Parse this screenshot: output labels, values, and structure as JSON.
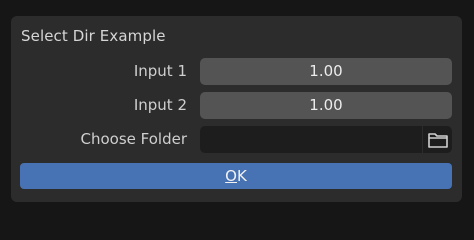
{
  "dialog": {
    "title": "Select Dir Example",
    "fields": [
      {
        "label": "Input 1",
        "value": "1.00"
      },
      {
        "label": "Input 2",
        "value": "1.00"
      }
    ],
    "folder": {
      "label": "Choose Folder",
      "value": "",
      "icon": "folder-icon"
    },
    "ok_label": "OK"
  },
  "colors": {
    "background": "#161616",
    "panel": "#2c2c2c",
    "number_field": "#545454",
    "path_field": "#1d1d1d",
    "ok_button": "#4772b3"
  }
}
